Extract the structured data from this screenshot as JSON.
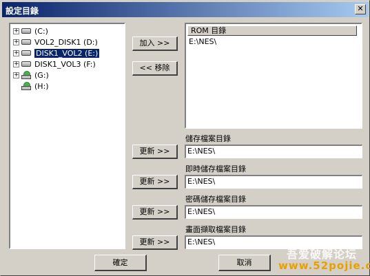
{
  "window": {
    "title": "設定目錄",
    "close_glyph": "✕"
  },
  "tree": {
    "items": [
      {
        "label": "(C:)",
        "type": "hdd",
        "expander": "+",
        "selected": false
      },
      {
        "label": "VOL2_DISK1 (D:)",
        "type": "hdd",
        "expander": "+",
        "selected": false
      },
      {
        "label": "DISK1_VOL2 (E:)",
        "type": "hdd",
        "expander": "+",
        "selected": true
      },
      {
        "label": "DISK1_VOL3 (F:)",
        "type": "hdd",
        "expander": "+",
        "selected": false
      },
      {
        "label": "(G:)",
        "type": "cdrom",
        "expander": "+",
        "selected": false
      },
      {
        "label": "(H:)",
        "type": "cdrom",
        "expander": "",
        "selected": false
      }
    ]
  },
  "buttons": {
    "add": "加入 >>",
    "remove": "<< 移除",
    "update": "更新 >>",
    "ok": "確定",
    "cancel": "取消"
  },
  "rom_list": {
    "header": "ROM 目錄",
    "items": [
      "E:\\NES\\"
    ]
  },
  "sections": [
    {
      "label": "儲存檔案目錄",
      "value": "E:\\NES\\"
    },
    {
      "label": "即時儲存檔案目錄",
      "value": "E:\\NES\\"
    },
    {
      "label": "密碼儲存檔案目錄",
      "value": "E:\\NES\\"
    },
    {
      "label": "畫面擷取檔案目錄",
      "value": "E:\\NES\\"
    }
  ],
  "overlay": {
    "line1": "吾爱破解论坛",
    "line2": "www.52pojie.cn"
  }
}
